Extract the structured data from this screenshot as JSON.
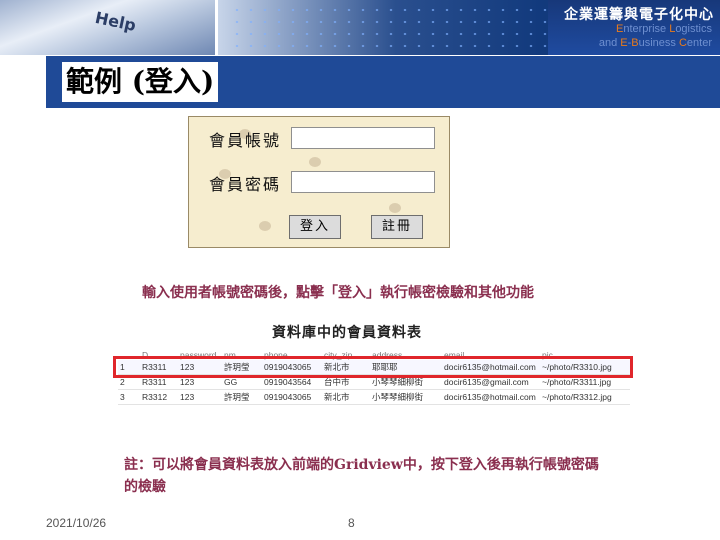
{
  "header": {
    "org_cn": "企業運籌與電子化中心",
    "org_en_line1_pre": "",
    "org_en_line1_e": "E",
    "org_en_line1_mid": "nterprise ",
    "org_en_line1_l": "L",
    "org_en_line1_post": "ogistics",
    "org_en_line2_pre": "and ",
    "org_en_line2_e": "E",
    "org_en_line2_mid": "-",
    "org_en_line2_b": "B",
    "org_en_line2_post": "usiness ",
    "org_en_line2_c": "C",
    "org_en_line2_end": "enter",
    "key_text": "Help",
    "accent_color": "#e87a1c"
  },
  "title": "範例 (登入)",
  "login_form": {
    "account_label": "會員帳號",
    "password_label": "會員密碼",
    "account_value": "",
    "password_value": "",
    "login_button": "登入",
    "register_button": "註冊"
  },
  "description": "輸入使用者帳號密碼後，點擊「登入」執行帳密檢驗和其他功能",
  "table_caption": "資料庫中的會員資料表",
  "grid": {
    "columns": [
      "",
      "D",
      "password",
      "nm",
      "phone",
      "city_zip",
      "address",
      "email",
      "pic"
    ],
    "rows": [
      [
        "1",
        "R3311",
        "123",
        "許玥瑩",
        "0919043065",
        "新北市",
        "耶耶耶",
        "docir6135@hotmail.com",
        "~/photo/R3310.jpg"
      ],
      [
        "2",
        "R3311",
        "123",
        "GG",
        "0919043564",
        "台中市",
        "小琴琴細柳街",
        "docir6135@gmail.com",
        "~/photo/R3311.jpg"
      ],
      [
        "3",
        "R3312",
        "123",
        "許玥瑩",
        "0919043065",
        "新北市",
        "小琴琴細柳街",
        "docir6135@hotmail.com",
        "~/photo/R3312.jpg"
      ]
    ],
    "highlight_color": "#e0262b"
  },
  "note": "註：可以將會員資料表放入前端的Gridview中，按下登入後再執行帳號密碼的檢驗",
  "footer": {
    "date": "2021/10/26",
    "page": "8"
  }
}
